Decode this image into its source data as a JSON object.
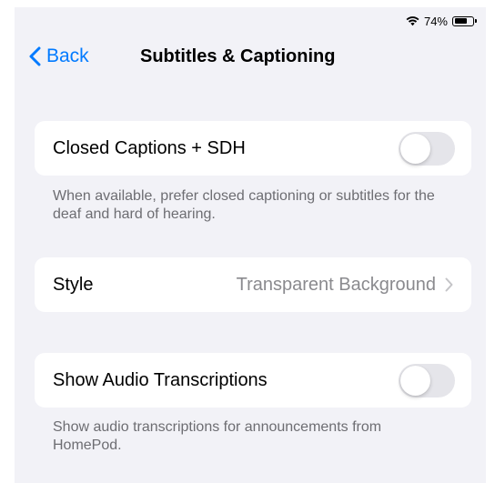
{
  "status_bar": {
    "battery_text": "74%",
    "battery_level": 0.74,
    "wifi_icon": "wifi-icon"
  },
  "nav": {
    "back_label": "Back",
    "title": "Subtitles & Captioning"
  },
  "closed_captions": {
    "label": "Closed Captions + SDH",
    "enabled": false,
    "footer": "When available, prefer closed captioning or subtitles for the deaf and hard of hearing."
  },
  "style": {
    "label": "Style",
    "value": "Transparent Background"
  },
  "audio_transcriptions": {
    "label": "Show Audio Transcriptions",
    "enabled": false,
    "footer": "Show audio transcriptions for announcements from HomePod."
  },
  "colors": {
    "accent": "#007aff",
    "background": "#f2f2f7",
    "toggle_off": "#e5e5ea",
    "secondary_text": "#8a8a8e",
    "footer_text": "#6d6d72"
  }
}
